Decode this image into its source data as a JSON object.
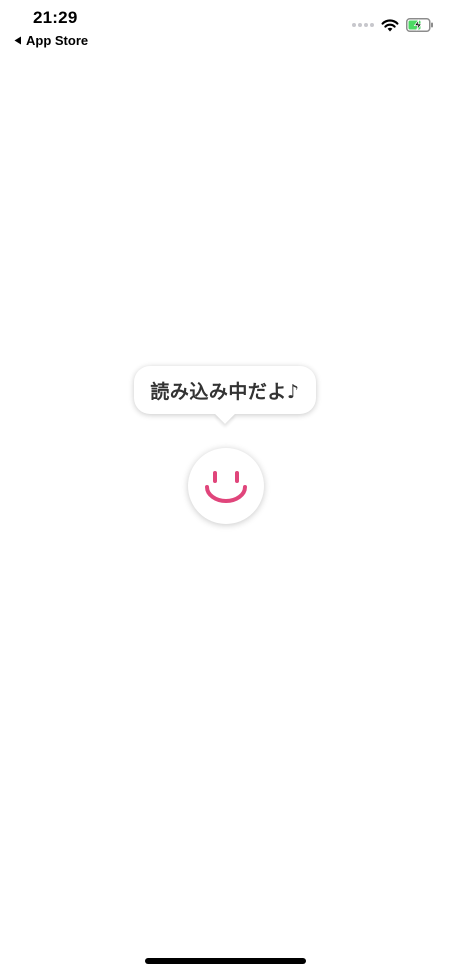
{
  "status_bar": {
    "time": "21:29",
    "back_label": "App Store",
    "icons": [
      "signal-dots-icon",
      "wifi-icon",
      "battery-charging-icon"
    ],
    "battery_color": "#4cd964"
  },
  "loading": {
    "message": "読み込み中だよ♪",
    "mascot_icon": "smiley-face-icon",
    "accent_color": "#e0457b"
  }
}
